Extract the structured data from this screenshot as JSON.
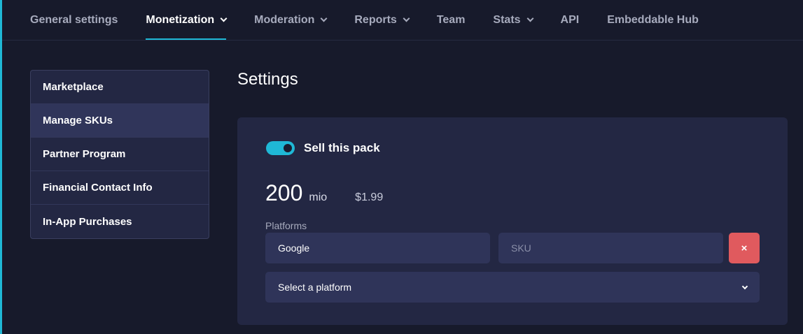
{
  "nav": {
    "items": [
      {
        "label": "General settings"
      },
      {
        "label": "Monetization"
      },
      {
        "label": "Moderation"
      },
      {
        "label": "Reports"
      },
      {
        "label": "Team"
      },
      {
        "label": "Stats"
      },
      {
        "label": "API"
      },
      {
        "label": "Embeddable Hub"
      }
    ]
  },
  "sidebar": {
    "items": [
      {
        "label": "Marketplace"
      },
      {
        "label": "Manage SKUs"
      },
      {
        "label": "Partner Program"
      },
      {
        "label": "Financial Contact Info"
      },
      {
        "label": "In-App Purchases"
      }
    ]
  },
  "main": {
    "title": "Settings",
    "sell_toggle": {
      "label": "Sell this pack",
      "on": true
    },
    "pack": {
      "amount": "200",
      "unit": "mio",
      "price": "$1.99"
    },
    "platforms": {
      "label": "Platforms",
      "selected_platform": "Google",
      "sku_placeholder": "SKU",
      "remove_label": "×",
      "select_placeholder": "Select a platform"
    }
  },
  "colors": {
    "accent": "#1fb8d6",
    "background": "#171a2b",
    "card": "#232743",
    "danger": "#e05a5e"
  }
}
